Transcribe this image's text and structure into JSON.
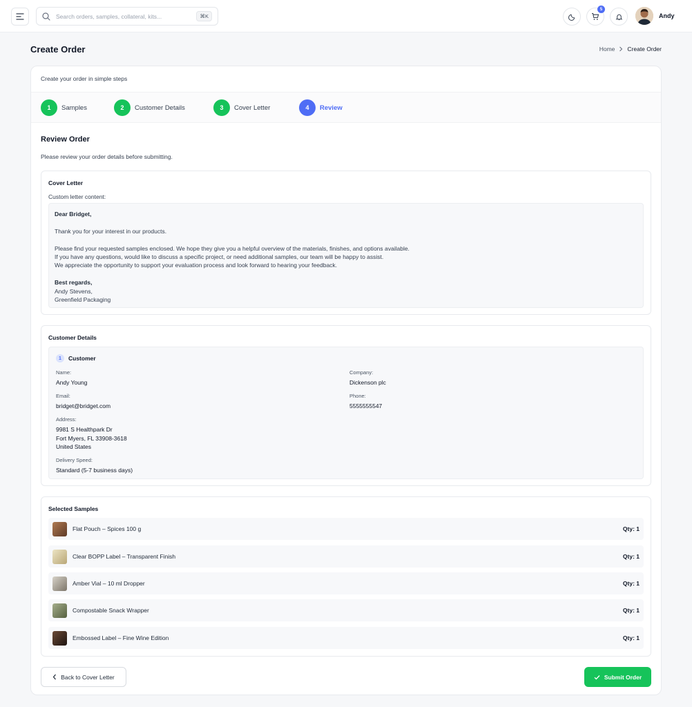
{
  "header": {
    "search_placeholder": "Search orders, samples, collateral, kits...",
    "search_shortcut": "⌘K",
    "cart_count": "5",
    "user_name": "Andy"
  },
  "page": {
    "title": "Create Order",
    "breadcrumb": {
      "home": "Home",
      "current": "Create Order"
    }
  },
  "wizard": {
    "subtitle": "Create your order in simple steps",
    "steps": [
      {
        "num": "1",
        "label": "Samples",
        "state": "done"
      },
      {
        "num": "2",
        "label": "Customer Details",
        "state": "done"
      },
      {
        "num": "3",
        "label": "Cover Letter",
        "state": "done"
      },
      {
        "num": "4",
        "label": "Review",
        "state": "active"
      }
    ]
  },
  "review": {
    "title": "Review Order",
    "subtitle": "Please review your order details before submitting."
  },
  "cover_letter": {
    "title": "Cover Letter",
    "label": "Custom letter content:",
    "greeting": "Dear Bridget,",
    "line1": "Thank you for your interest in our products.",
    "line2": "Please find your requested samples enclosed. We hope they give you a helpful overview of the materials, finishes, and options available.",
    "line3": "If you have any questions, would like to discuss a specific project, or need additional samples, our team will be happy to assist.",
    "line4": "We appreciate the opportunity to support your evaluation process and look forward to hearing your feedback.",
    "closing": "Best regards,",
    "signer": "Andy Stevens,",
    "company": "Greenfield Packaging"
  },
  "customer_details": {
    "title": "Customer Details",
    "customer_num": "1",
    "customer_label": "Customer",
    "name_label": "Name:",
    "name": "Andy Young",
    "company_label": "Company:",
    "company": "Dickenson plc",
    "email_label": "Email:",
    "email": "bridget@bridget.com",
    "phone_label": "Phone:",
    "phone": "5555555547",
    "address_label": "Address:",
    "address_line1": "9981 S Healthpark Dr",
    "address_line2": "Fort Myers, FL 33908-3618",
    "address_line3": "United States",
    "delivery_label": "Delivery Speed:",
    "delivery": "Standard (5-7 business days)"
  },
  "samples": {
    "title": "Selected Samples",
    "items": [
      {
        "name": "Flat Pouch – Spices 100 g",
        "qty": "Qty: 1",
        "thumb_color": "#8a5a3c"
      },
      {
        "name": "Clear BOPP Label – Transparent Finish",
        "qty": "Qty: 1",
        "thumb_color": "#d9cfa8"
      },
      {
        "name": "Amber Vial – 10 ml Dropper",
        "qty": "Qty: 1",
        "thumb_color": "#b8b2a6"
      },
      {
        "name": "Compostable Snack Wrapper",
        "qty": "Qty: 1",
        "thumb_color": "#7f8a6a"
      },
      {
        "name": "Embossed Label – Fine Wine Edition",
        "qty": "Qty: 1",
        "thumb_color": "#3b2a22"
      }
    ]
  },
  "actions": {
    "back_label": "Back to Cover Letter",
    "submit_label": "Submit Order"
  },
  "colors": {
    "primary": "#4f6df5",
    "success": "#16c35a"
  }
}
